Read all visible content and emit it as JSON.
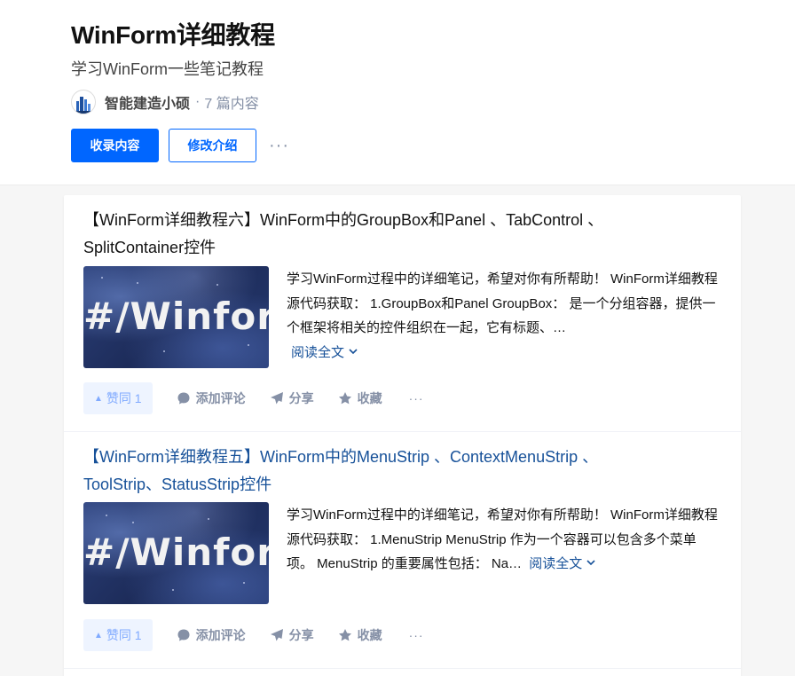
{
  "column": {
    "title": "WinForm详细教程",
    "description": "学习WinForm一些笔记教程",
    "author": "智能建造小硕",
    "separator": "·",
    "count": "7 篇内容"
  },
  "buttons": {
    "collect": "收录内容",
    "edit": "修改介绍",
    "more": "···"
  },
  "articles": [
    {
      "title": "【WinForm详细教程六】WinForm中的GroupBox和Panel 、TabControl 、SplitContainer控件",
      "thumb_text": "#/Winfor",
      "excerpt": "学习WinForm过程中的详细笔记，希望对你有所帮助！ WinForm详细教程源代码获取： 1.GroupBox和Panel GroupBox： 是一个分组容器，提供一个框架将相关的控件组织在一起，它有标题、…",
      "read_more": "阅读全文",
      "vote": "赞同 1",
      "comment": "添加评论",
      "share": "分享",
      "favorite": "收藏",
      "more": "···"
    },
    {
      "title": "【WinForm详细教程五】WinForm中的MenuStrip 、ContextMenuStrip 、ToolStrip、StatusStrip控件",
      "thumb_text": "#/Winfor",
      "excerpt": "学习WinForm过程中的详细笔记，希望对你有所帮助！ WinForm详细教程源代码获取： 1.MenuStrip MenuStrip 作为一个容器可以包含多个菜单项。 MenuStrip 的重要属性包括： Na…",
      "read_more": "阅读全文",
      "vote": "赞同 1",
      "comment": "添加评论",
      "share": "分享",
      "favorite": "收藏",
      "more": "···"
    }
  ],
  "colors": {
    "primary": "#0066ff",
    "link": "#175199",
    "muted": "#8590a6",
    "vote_bg": "#eef4ff"
  }
}
